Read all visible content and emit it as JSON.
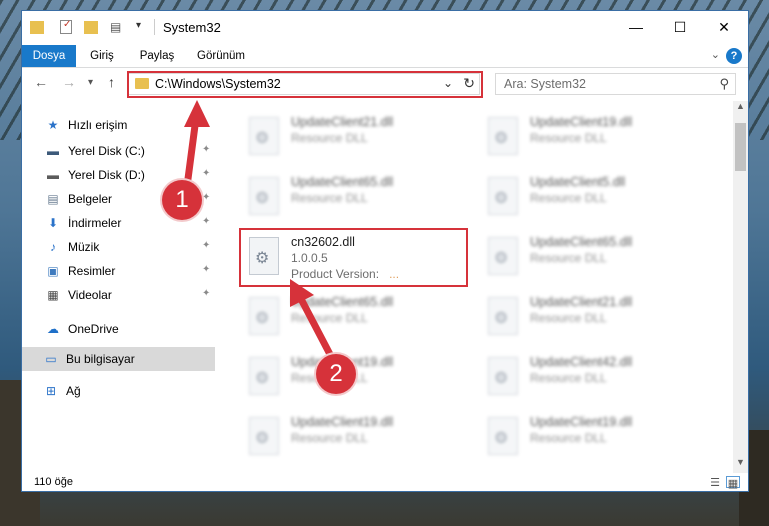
{
  "window": {
    "title": "System32",
    "minimize_glyph": "—",
    "maximize_glyph": "☐",
    "close_glyph": "✕"
  },
  "ribbon": {
    "tabs": [
      {
        "label": "Dosya",
        "active": true
      },
      {
        "label": "Giriş",
        "active": false
      },
      {
        "label": "Paylaş",
        "active": false
      },
      {
        "label": "Görünüm",
        "active": false
      }
    ],
    "help_glyph": "?"
  },
  "address": {
    "path": "C:\\Windows\\System32",
    "search_placeholder": "Ara: System32"
  },
  "sidebar": {
    "items": [
      {
        "label": "Hızlı erişim",
        "icon": "star-icon",
        "glyph": "★",
        "color": "#2b73c9",
        "pinned": false,
        "selected": false
      },
      {
        "label": "Yerel Disk (C:)",
        "icon": "drive-icon",
        "glyph": "▬",
        "color": "#3d5a7a",
        "pinned": true,
        "selected": false
      },
      {
        "label": "Yerel Disk (D:)",
        "icon": "drive-icon",
        "glyph": "▬",
        "color": "#5b5b5b",
        "pinned": true,
        "selected": false
      },
      {
        "label": "Belgeler",
        "icon": "documents-icon",
        "glyph": "▤",
        "color": "#6a7d92",
        "pinned": true,
        "selected": false
      },
      {
        "label": "İndirmeler",
        "icon": "download-icon",
        "glyph": "⬇",
        "color": "#2b73c9",
        "pinned": true,
        "selected": false
      },
      {
        "label": "Müzik",
        "icon": "music-icon",
        "glyph": "♪",
        "color": "#2b73c9",
        "pinned": true,
        "selected": false
      },
      {
        "label": "Resimler",
        "icon": "pictures-icon",
        "glyph": "▣",
        "color": "#3f7bbf",
        "pinned": true,
        "selected": false
      },
      {
        "label": "Videolar",
        "icon": "videos-icon",
        "glyph": "▦",
        "color": "#4a4a4a",
        "pinned": true,
        "selected": false
      },
      {
        "label": "OneDrive",
        "icon": "onedrive-icon",
        "glyph": "☁",
        "color": "#1e6fc8",
        "pinned": false,
        "selected": false
      },
      {
        "label": "Bu bilgisayar",
        "icon": "computer-icon",
        "glyph": "▭",
        "color": "#2b73c9",
        "pinned": false,
        "selected": true
      },
      {
        "label": "Ağ",
        "icon": "network-icon",
        "glyph": "⊞",
        "color": "#2b73c9",
        "pinned": false,
        "selected": false
      }
    ],
    "pin_glyph": "✦"
  },
  "files": [
    {
      "name": "UpdateClient21.dll",
      "desc": "Resource DLL"
    },
    {
      "name": "UpdateClient19.dll",
      "desc": "Resource DLL"
    },
    {
      "name": "UpdateClient65.dll",
      "desc": "Resource DLL"
    },
    {
      "name": "UpdateClient5.dll",
      "desc": "Resource DLL"
    },
    {
      "name": "cn32602.dll",
      "desc": "1.0.0.5",
      "product": "Product Version:",
      "product_value": "...",
      "highlight": true
    },
    {
      "name": "UpdateClient65.dll",
      "desc": "Resource DLL"
    },
    {
      "name": "UpdateClient65.dll",
      "desc": "Resource DLL"
    },
    {
      "name": "UpdateClient21.dll",
      "desc": "Resource DLL"
    },
    {
      "name": "UpdateClient19.dll",
      "desc": "Resource DLL"
    },
    {
      "name": "UpdateClient42.dll",
      "desc": "Resource DLL"
    },
    {
      "name": "UpdateClient19.dll",
      "desc": "Resource DLL"
    },
    {
      "name": "UpdateClient19.dll",
      "desc": "Resource DLL"
    }
  ],
  "status": {
    "count": "110 öğe"
  },
  "annotations": {
    "badge1": "1",
    "badge2": "2",
    "color": "#d6323a"
  }
}
